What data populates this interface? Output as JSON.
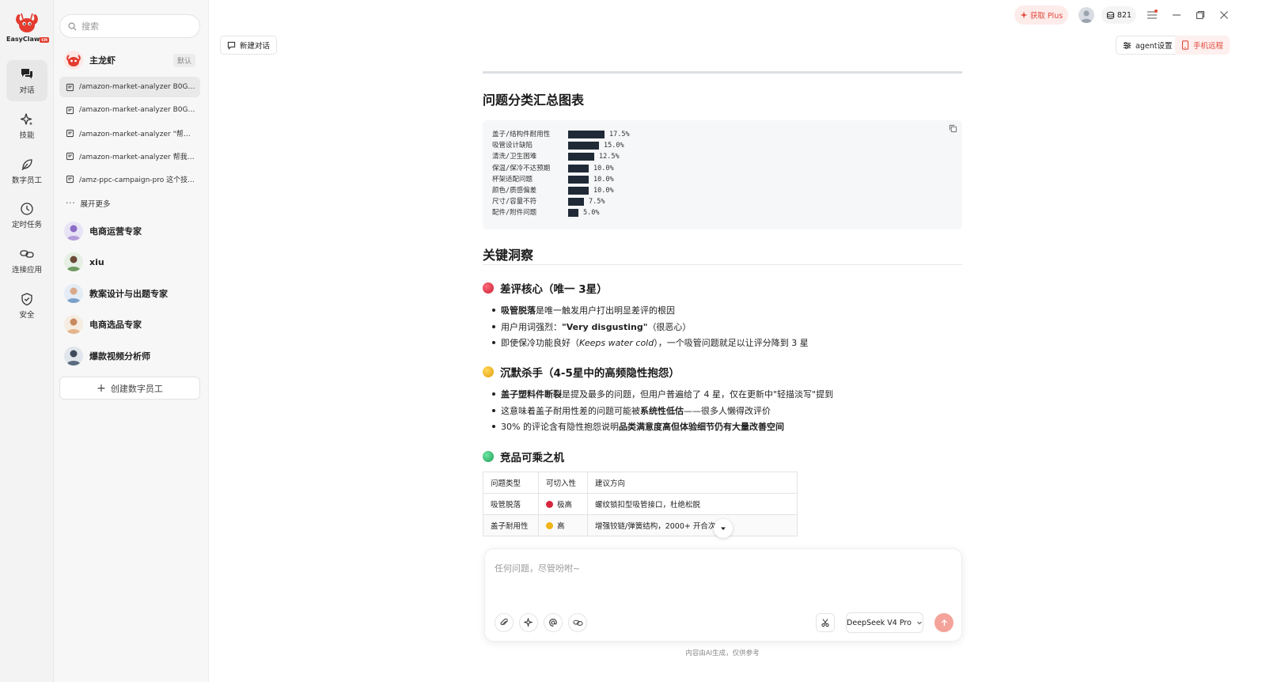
{
  "brand": {
    "name": "EasyClaw",
    "badge": "cn"
  },
  "rail": {
    "items": [
      {
        "label": "对话",
        "icon": "chat-icon"
      },
      {
        "label": "技能",
        "icon": "sparkle-icon"
      },
      {
        "label": "数字员工",
        "icon": "leaf-icon"
      },
      {
        "label": "定时任务",
        "icon": "clock-icon"
      },
      {
        "label": "连接应用",
        "icon": "link-icon"
      },
      {
        "label": "安全",
        "icon": "shield-icon"
      }
    ]
  },
  "sidebar": {
    "search_placeholder": "搜索",
    "main_agent": {
      "name": "主龙虾",
      "tag": "默认"
    },
    "conversations": [
      "/amazon-market-analyzer B0GJS6...",
      "/amazon-market-analyzer B0GJS6...",
      "/amazon-market-analyzer \"帮我...",
      "/amazon-market-analyzer 帮我精...",
      "/amz-ppc-campaign-pro 这个技..."
    ],
    "more_label": "展开更多",
    "agents": [
      "电商运营专家",
      "xiu",
      "教案设计与出题专家",
      "电商选品专家",
      "爆款视频分析师"
    ],
    "create_label": "创建数字员工"
  },
  "topbar": {
    "new_chat": "新建对话",
    "get_plus": "获取 Plus",
    "credits": "821",
    "agent_settings": "agent设置",
    "mobile_remote": "手机远程"
  },
  "content": {
    "chart_title": "问题分类汇总图表",
    "chart_rows": [
      {
        "label": "盖子/结构件耐用性",
        "pct": "17.5%",
        "value": 17.5
      },
      {
        "label": "吸管设计缺陷",
        "pct": "15.0%",
        "value": 15.0
      },
      {
        "label": "清洗/卫生困难",
        "pct": "12.5%",
        "value": 12.5
      },
      {
        "label": "保温/保冷不达预期",
        "pct": "10.0%",
        "value": 10.0
      },
      {
        "label": "杯架适配问题",
        "pct": "10.0%",
        "value": 10.0
      },
      {
        "label": "颜色/质感偏差",
        "pct": "10.0%",
        "value": 10.0
      },
      {
        "label": "尺寸/容量不符",
        "pct": "7.5%",
        "value": 7.5
      },
      {
        "label": "配件/附件问题",
        "pct": "5.0%",
        "value": 5.0
      }
    ],
    "insights_title": "关键洞察",
    "sec1": {
      "title": "差评核心（唯一 3星）",
      "b1_bold": "吸管脱落",
      "b1_rest": "是唯一触发用户打出明显差评的根因",
      "b2_pre": "用户用词强烈：",
      "b2_bold": "\"Very disgusting\"",
      "b2_post": "（很恶心）",
      "b3_pre": "即使保冷功能良好（",
      "b3_italic": "Keeps water cold",
      "b3_post": "），一个吸管问题就足以让评分降到 3 星"
    },
    "sec2": {
      "title": "沉默杀手（4-5星中的高频隐性抱怨）",
      "b1_bold": "盖子塑料件断裂",
      "b1_rest": "是提及最多的问题，但用户普遍给了 4 星，仅在更新中\"轻描淡写\"提到",
      "b2_pre": "这意味着盖子耐用性差的问题可能被",
      "b2_bold": "系统性低估",
      "b2_post": "——很多人懒得改评价",
      "b3_pre": "30% 的评论含有隐性抱怨说明",
      "b3_bold": "品类满意度高但体验细节仍有大量改善空间"
    },
    "sec3": {
      "title": "竞品可乘之机",
      "headers": [
        "问题类型",
        "可切入性",
        "建议方向"
      ],
      "rows": [
        {
          "type": "吸管脱落",
          "level": "极高",
          "dir": "螺纹锁扣型吸管接口，杜绝松脱"
        },
        {
          "type": "盖子耐用性",
          "level": "高",
          "dir": "增强铰链/弹簧结构，2000+ 开合次认证"
        }
      ]
    }
  },
  "composer": {
    "placeholder": "任何问题，尽管吩咐~",
    "model": "DeepSeek V4 Pro",
    "disclaimer": "内容由AI生成，仅供参考"
  },
  "colors": {
    "accent": "#e2483b",
    "dot_red": "#d7263d",
    "dot_yellow": "#f2b416",
    "dot_green": "#2fbf71",
    "bar": "#1f2a36"
  }
}
